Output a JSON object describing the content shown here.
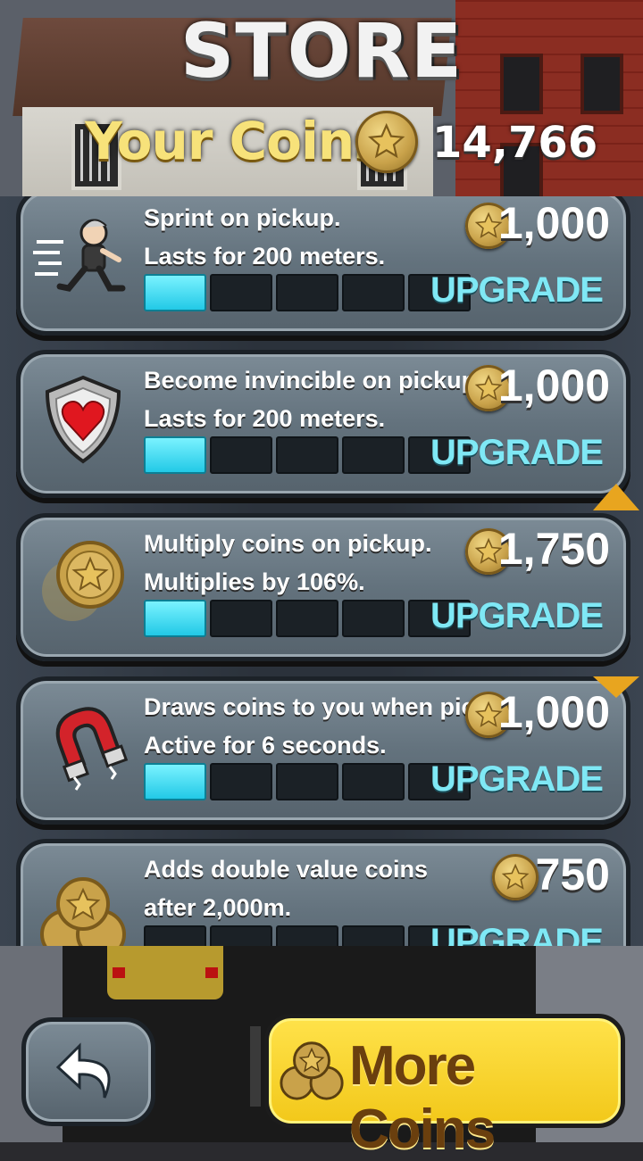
{
  "header": {
    "title": "STORE",
    "coins_label": "Your Coins",
    "coins_value": "14,766"
  },
  "upgrade_label": "UPGRADE",
  "items": [
    {
      "line1": "Sprint on pickup.",
      "line2": "Lasts for 200 meters.",
      "price": "1,000",
      "level": 1,
      "max_level": 5,
      "icon": "sprint-granny-icon"
    },
    {
      "line1": "Become invincible on pickup.",
      "line2": "Lasts for 200 meters.",
      "price": "1,000",
      "level": 1,
      "max_level": 5,
      "icon": "heart-shield-icon"
    },
    {
      "line1": "Multiply coins on pickup.",
      "line2": "Multiplies by 106%.",
      "price": "1,750",
      "level": 1,
      "max_level": 5,
      "icon": "coin-multiplier-icon"
    },
    {
      "line1": "Draws coins to you when picked",
      "line2": "Active for 6 seconds.",
      "price": "1,000",
      "level": 1,
      "max_level": 5,
      "icon": "magnet-icon"
    },
    {
      "line1": "Adds double value coins",
      "line2": "after 2,000m.",
      "price": "750",
      "level": 0,
      "max_level": 5,
      "icon": "coin-stack-icon"
    }
  ],
  "bottom": {
    "back_icon": "back-arrow-icon",
    "more_coins_label": "More Coins"
  },
  "colors": {
    "progress_on": "#22c9e6",
    "upgrade_text": "#7fe8f5",
    "more_coins_button": "#f2c81a"
  }
}
